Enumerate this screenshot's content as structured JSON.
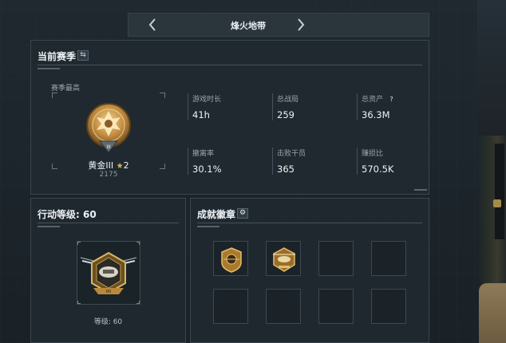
{
  "mode_selector": {
    "title": "烽火地带",
    "prev_icon": "chevron-left-icon",
    "next_icon": "chevron-right-icon"
  },
  "season": {
    "header": "当前赛季",
    "swap_icon": "swap-icon",
    "rank_label": "赛季最高",
    "rank_name": "黄金III",
    "rank_stars": "2",
    "rank_points": "2175",
    "stats": [
      {
        "label": "游戏时长",
        "value": "41h"
      },
      {
        "label": "总战局",
        "value": "259"
      },
      {
        "label": "总资产",
        "value": "36.3M",
        "help": "?"
      },
      {
        "label": "撤离率",
        "value": "30.1%"
      },
      {
        "label": "击败干员",
        "value": "365"
      },
      {
        "label": "赚损比",
        "value": "570.5K"
      }
    ]
  },
  "action": {
    "header": "行动等级: 60",
    "level_text": "等级: 60"
  },
  "badges": {
    "header": "成就徽章",
    "gear_icon": "gear-icon"
  },
  "colors": {
    "background": "#1b2329",
    "panel": "#202930",
    "gold": "#c9a24e"
  }
}
